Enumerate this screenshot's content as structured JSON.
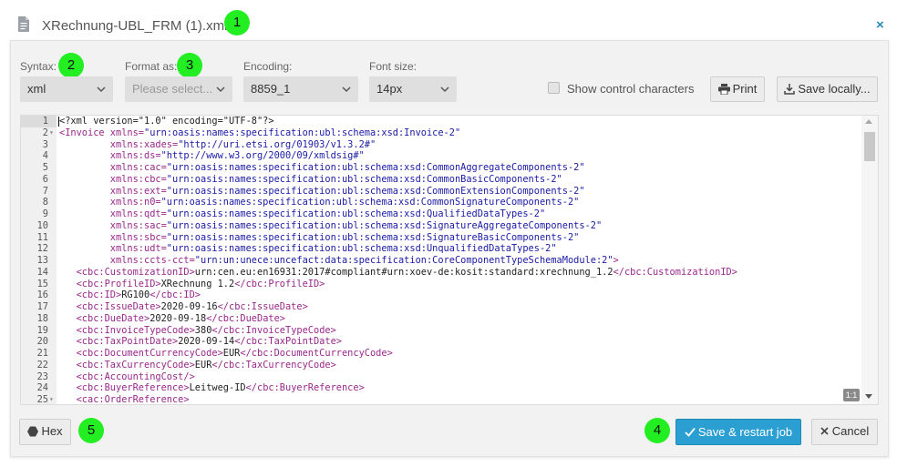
{
  "dialog": {
    "title": "XRechnung-UBL_FRM (1).xml",
    "close_glyph": "×",
    "icon": "file-icon"
  },
  "badges": [
    "1",
    "2",
    "3",
    "4",
    "5"
  ],
  "toolbar": {
    "syntax_label": "Syntax:",
    "syntax_value": "xml",
    "format_label": "Format as:",
    "format_placeholder": "Please select...",
    "encoding_label": "Encoding:",
    "encoding_value": "8859_1",
    "fontsize_label": "Font size:",
    "fontsize_value": "14px",
    "control_chars_label": "Show control characters",
    "control_chars_checked": false,
    "print_label": "Print",
    "save_locally_label": "Save locally..."
  },
  "editor": {
    "zoom_label": "1:1",
    "lines": [
      {
        "n": "1",
        "fold": "",
        "parts": [
          [
            "txt",
            "<?xml version=\"1.0\" encoding=\"UTF-8\"?>"
          ]
        ]
      },
      {
        "n": "2",
        "fold": "▾",
        "parts": [
          [
            "tag",
            "<Invoice xmlns="
          ],
          [
            "str",
            "\"urn:oasis:names:specification:ubl:schema:xsd:Invoice-2\""
          ]
        ]
      },
      {
        "n": "3",
        "fold": "",
        "parts": [
          [
            "tag",
            "         xmlns:xades="
          ],
          [
            "str",
            "\"http://uri.etsi.org/01903/v1.3.2#\""
          ]
        ]
      },
      {
        "n": "4",
        "fold": "",
        "parts": [
          [
            "tag",
            "         xmlns:ds="
          ],
          [
            "str",
            "\"http://www.w3.org/2000/09/xmldsig#\""
          ]
        ]
      },
      {
        "n": "5",
        "fold": "",
        "parts": [
          [
            "tag",
            "         xmlns:cac="
          ],
          [
            "str",
            "\"urn:oasis:names:specification:ubl:schema:xsd:CommonAggregateComponents-2\""
          ]
        ]
      },
      {
        "n": "6",
        "fold": "",
        "parts": [
          [
            "tag",
            "         xmlns:cbc="
          ],
          [
            "str",
            "\"urn:oasis:names:specification:ubl:schema:xsd:CommonBasicComponents-2\""
          ]
        ]
      },
      {
        "n": "7",
        "fold": "",
        "parts": [
          [
            "tag",
            "         xmlns:ext="
          ],
          [
            "str",
            "\"urn:oasis:names:specification:ubl:schema:xsd:CommonExtensionComponents-2\""
          ]
        ]
      },
      {
        "n": "8",
        "fold": "",
        "parts": [
          [
            "tag",
            "         xmlns:n0="
          ],
          [
            "str",
            "\"urn:oasis:names:specification:ubl:schema:xsd:CommonSignatureComponents-2\""
          ]
        ]
      },
      {
        "n": "9",
        "fold": "",
        "parts": [
          [
            "tag",
            "         xmlns:qdt="
          ],
          [
            "str",
            "\"urn:oasis:names:specification:ubl:schema:xsd:QualifiedDataTypes-2\""
          ]
        ]
      },
      {
        "n": "10",
        "fold": "",
        "parts": [
          [
            "tag",
            "         xmlns:sac="
          ],
          [
            "str",
            "\"urn:oasis:names:specification:ubl:schema:xsd:SignatureAggregateComponents-2\""
          ]
        ]
      },
      {
        "n": "11",
        "fold": "",
        "parts": [
          [
            "tag",
            "         xmlns:sbc="
          ],
          [
            "str",
            "\"urn:oasis:names:specification:ubl:schema:xsd:SignatureBasicComponents-2\""
          ]
        ]
      },
      {
        "n": "12",
        "fold": "",
        "parts": [
          [
            "tag",
            "         xmlns:udt="
          ],
          [
            "str",
            "\"urn:oasis:names:specification:ubl:schema:xsd:UnqualifiedDataTypes-2\""
          ]
        ]
      },
      {
        "n": "13",
        "fold": "",
        "parts": [
          [
            "tag",
            "         xmlns:ccts-cct="
          ],
          [
            "str",
            "\"urn:un:unece:uncefact:data:specification:CoreComponentTypeSchemaModule:2\""
          ],
          [
            "tag",
            ">"
          ]
        ]
      },
      {
        "n": "14",
        "fold": "",
        "parts": [
          [
            "tag",
            "   <cbc:CustomizationID>"
          ],
          [
            "txt",
            "urn:cen.eu:en16931:2017#compliant#urn:xoev-de:kosit:standard:xrechnung_1.2"
          ],
          [
            "tag",
            "</cbc:CustomizationID>"
          ]
        ]
      },
      {
        "n": "15",
        "fold": "",
        "parts": [
          [
            "tag",
            "   <cbc:ProfileID>"
          ],
          [
            "txt",
            "XRechnung 1.2"
          ],
          [
            "tag",
            "</cbc:ProfileID>"
          ]
        ]
      },
      {
        "n": "16",
        "fold": "",
        "parts": [
          [
            "tag",
            "   <cbc:ID>"
          ],
          [
            "txt",
            "RG100"
          ],
          [
            "tag",
            "</cbc:ID>"
          ]
        ]
      },
      {
        "n": "17",
        "fold": "",
        "parts": [
          [
            "tag",
            "   <cbc:IssueDate>"
          ],
          [
            "txt",
            "2020-09-16"
          ],
          [
            "tag",
            "</cbc:IssueDate>"
          ]
        ]
      },
      {
        "n": "18",
        "fold": "",
        "parts": [
          [
            "tag",
            "   <cbc:DueDate>"
          ],
          [
            "txt",
            "2020-09-18"
          ],
          [
            "tag",
            "</cbc:DueDate>"
          ]
        ]
      },
      {
        "n": "19",
        "fold": "",
        "parts": [
          [
            "tag",
            "   <cbc:InvoiceTypeCode>"
          ],
          [
            "txt",
            "380"
          ],
          [
            "tag",
            "</cbc:InvoiceTypeCode>"
          ]
        ]
      },
      {
        "n": "20",
        "fold": "",
        "parts": [
          [
            "tag",
            "   <cbc:TaxPointDate>"
          ],
          [
            "txt",
            "2020-09-14"
          ],
          [
            "tag",
            "</cbc:TaxPointDate>"
          ]
        ]
      },
      {
        "n": "21",
        "fold": "",
        "parts": [
          [
            "tag",
            "   <cbc:DocumentCurrencyCode>"
          ],
          [
            "txt",
            "EUR"
          ],
          [
            "tag",
            "</cbc:DocumentCurrencyCode>"
          ]
        ]
      },
      {
        "n": "22",
        "fold": "",
        "parts": [
          [
            "tag",
            "   <cbc:TaxCurrencyCode>"
          ],
          [
            "txt",
            "EUR"
          ],
          [
            "tag",
            "</cbc:TaxCurrencyCode>"
          ]
        ]
      },
      {
        "n": "23",
        "fold": "",
        "parts": [
          [
            "tag",
            "   <cbc:AccountingCost/>"
          ]
        ]
      },
      {
        "n": "24",
        "fold": "",
        "parts": [
          [
            "tag",
            "   <cbc:BuyerReference>"
          ],
          [
            "txt",
            "Leitweg-ID"
          ],
          [
            "tag",
            "</cbc:BuyerReference>"
          ]
        ]
      },
      {
        "n": "25",
        "fold": "▾",
        "parts": [
          [
            "tag",
            "   <cac:OrderReference>"
          ]
        ]
      }
    ]
  },
  "footer": {
    "hex_label": "Hex",
    "save_restart_label": "Save & restart job",
    "cancel_label": "Cancel"
  }
}
